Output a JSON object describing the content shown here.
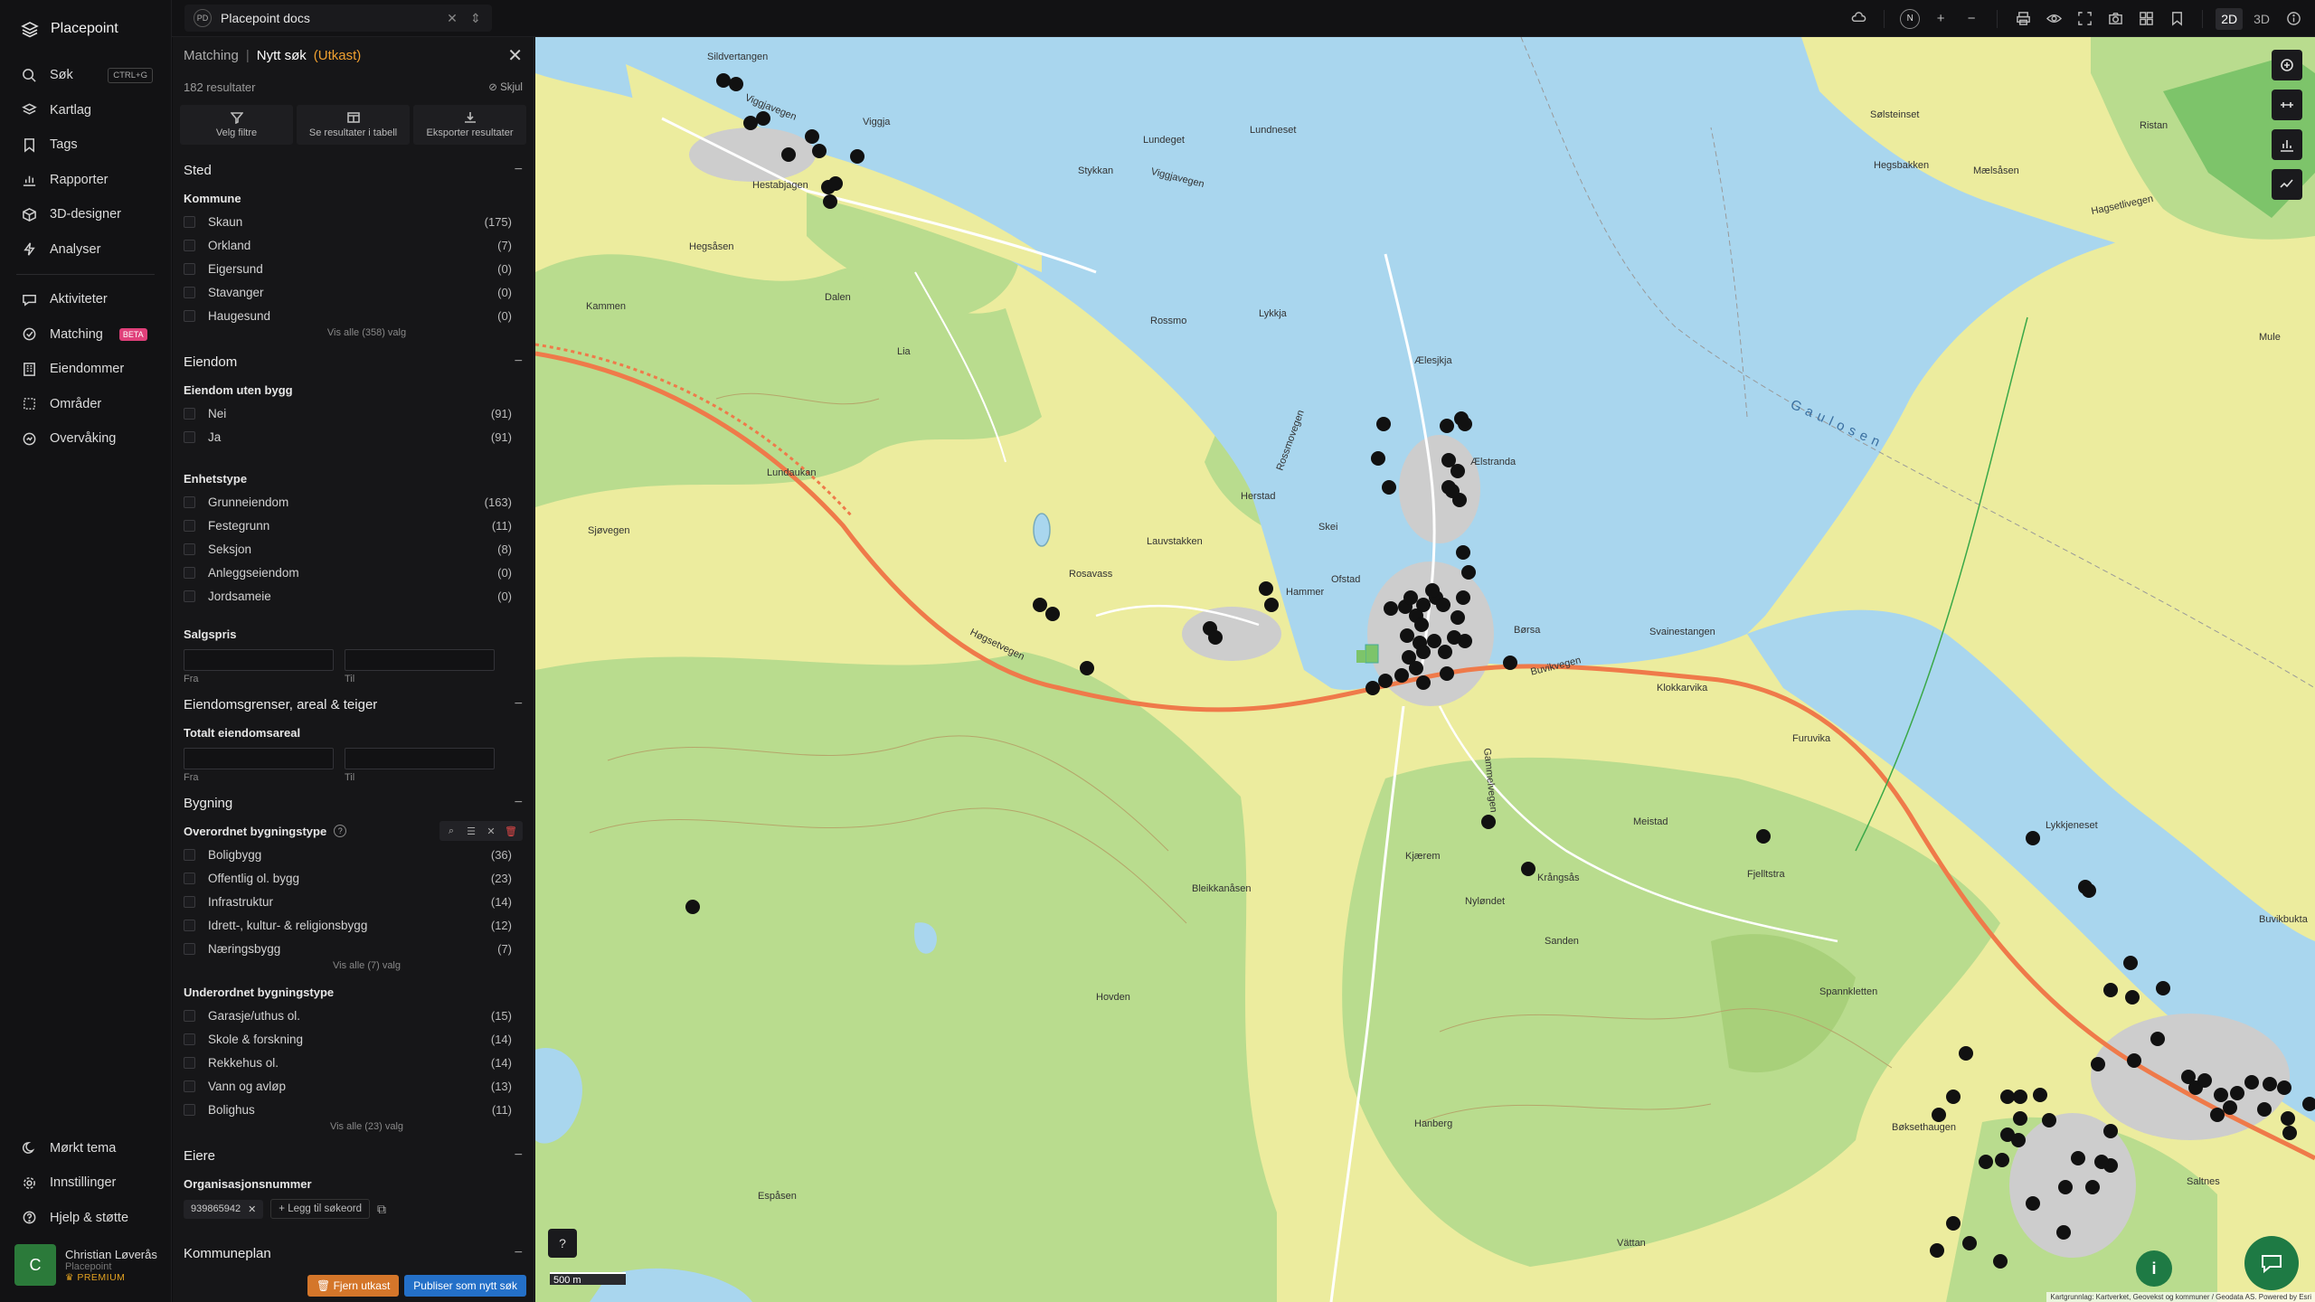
{
  "app": {
    "name": "Placepoint"
  },
  "workspace": {
    "badge": "PD",
    "name": "Placepoint docs"
  },
  "nav": {
    "items": [
      {
        "key": "sok",
        "label": "Søk",
        "shortcut": "CTRL+G",
        "icon": "search-icon"
      },
      {
        "key": "kartlag",
        "label": "Kartlag",
        "icon": "layers-icon"
      },
      {
        "key": "tags",
        "label": "Tags",
        "icon": "bookmark-icon"
      },
      {
        "key": "rapporter",
        "label": "Rapporter",
        "icon": "chart-icon"
      },
      {
        "key": "3d",
        "label": "3D-designer",
        "icon": "cube-icon"
      },
      {
        "key": "analyser",
        "label": "Analyser",
        "icon": "bolt-icon"
      }
    ],
    "items2": [
      {
        "key": "aktiviteter",
        "label": "Aktiviteter",
        "icon": "chat-icon"
      },
      {
        "key": "matching",
        "label": "Matching",
        "badge": "BETA",
        "icon": "match-icon"
      },
      {
        "key": "eiendommer",
        "label": "Eiendommer",
        "icon": "building-icon"
      },
      {
        "key": "omrader",
        "label": "Områder",
        "icon": "area-icon"
      },
      {
        "key": "overvaking",
        "label": "Overvåking",
        "icon": "monitor-icon"
      }
    ],
    "bottom": [
      {
        "key": "theme",
        "label": "Mørkt tema",
        "icon": "moon-icon"
      },
      {
        "key": "settings",
        "label": "Innstillinger",
        "icon": "gear-icon"
      },
      {
        "key": "help",
        "label": "Hjelp & støtte",
        "icon": "help-icon"
      }
    ],
    "user": {
      "initial": "C",
      "name": "Christian Løverås",
      "org": "Placepoint",
      "plan": "PREMIUM"
    }
  },
  "topbar": {
    "compass": "N",
    "mode_2d": "2D",
    "mode_3d": "3D"
  },
  "panel": {
    "crumb": "Matching",
    "title": "Nytt søk",
    "status": "(Utkast)",
    "results": "182 resultater",
    "hide": "Skjul",
    "actions": [
      "Velg filtre",
      "Se resultater i tabell",
      "Eksporter resultater"
    ],
    "sted": {
      "title": "Sted",
      "kommune_label": "Kommune",
      "kommune": [
        {
          "label": "Skaun",
          "count": "(175)"
        },
        {
          "label": "Orkland",
          "count": "(7)"
        },
        {
          "label": "Eigersund",
          "count": "(0)"
        },
        {
          "label": "Stavanger",
          "count": "(0)"
        },
        {
          "label": "Haugesund",
          "count": "(0)"
        }
      ],
      "show_all": "Vis alle (358) valg"
    },
    "eiendom": {
      "title": "Eiendom",
      "uten_bygg_label": "Eiendom uten bygg",
      "uten_bygg": [
        {
          "label": "Nei",
          "count": "(91)"
        },
        {
          "label": "Ja",
          "count": "(91)"
        }
      ],
      "enhetstype_label": "Enhetstype",
      "enhetstype": [
        {
          "label": "Grunneiendom",
          "count": "(163)"
        },
        {
          "label": "Festegrunn",
          "count": "(11)"
        },
        {
          "label": "Seksjon",
          "count": "(8)"
        },
        {
          "label": "Anleggseiendom",
          "count": "(0)"
        },
        {
          "label": "Jordsameie",
          "count": "(0)"
        }
      ],
      "salgspris_label": "Salgspris",
      "from": "Fra",
      "to": "Til"
    },
    "grenser": {
      "title": "Eiendomsgrenser, areal & teiger",
      "areal_label": "Totalt eiendomsareal",
      "from": "Fra",
      "to": "Til"
    },
    "bygning": {
      "title": "Bygning",
      "overordnet_label": "Overordnet bygningstype",
      "overordnet": [
        {
          "label": "Boligbygg",
          "count": "(36)"
        },
        {
          "label": "Offentlig ol. bygg",
          "count": "(23)"
        },
        {
          "label": "Infrastruktur",
          "count": "(14)"
        },
        {
          "label": "Idrett-, kultur- & religionsbygg",
          "count": "(12)"
        },
        {
          "label": "Næringsbygg",
          "count": "(7)"
        }
      ],
      "overordnet_show_all": "Vis alle (7) valg",
      "underordnet_label": "Underordnet bygningstype",
      "underordnet": [
        {
          "label": "Garasje/uthus ol.",
          "count": "(15)"
        },
        {
          "label": "Skole & forskning",
          "count": "(14)"
        },
        {
          "label": "Rekkehus ol.",
          "count": "(14)"
        },
        {
          "label": "Vann og avløp",
          "count": "(13)"
        },
        {
          "label": "Bolighus",
          "count": "(11)"
        }
      ],
      "underordnet_show_all": "Vis alle (23) valg"
    },
    "eiere": {
      "title": "Eiere",
      "org_label": "Organisasjonsnummer",
      "org_value": "939865942",
      "add_label": "Legg til søkeord"
    },
    "kommuneplan": {
      "title": "Kommuneplan"
    },
    "footer": {
      "remove": "Fjern utkast",
      "publish": "Publiser som nytt søk"
    }
  },
  "map": {
    "scale": "500 m",
    "attribution": "Kartgrunnlag: Kartverket, Geovekst og kommuner / Geodata AS. Powered by Esri",
    "colors": {
      "water": "#a9d6ee",
      "land": "#ecec9e",
      "forest": "#b7dc8f",
      "settlement": "#c9c9c9",
      "road": "#ef7a4a"
    },
    "labels": [
      {
        "text": "Sildvertangen"
      },
      {
        "text": "Viggjavegen"
      },
      {
        "text": "Viggja"
      },
      {
        "text": "Lundeget"
      },
      {
        "text": "Lundneset"
      },
      {
        "text": "Hestabjagen"
      },
      {
        "text": "Stykkan"
      },
      {
        "text": "Viggjavegen"
      },
      {
        "text": "Hegsåsen"
      },
      {
        "text": "Sjøvegen"
      },
      {
        "text": "Dalen"
      },
      {
        "text": "Kammen"
      },
      {
        "text": "Lia"
      },
      {
        "text": "Rossmo"
      },
      {
        "text": "Lykkja"
      },
      {
        "text": "Ælesjkja"
      },
      {
        "text": "Rossmovegen"
      },
      {
        "text": "Ælstranda"
      },
      {
        "text": "Herstad"
      },
      {
        "text": "Høgsetvegen"
      },
      {
        "text": "Rosavass"
      },
      {
        "text": "Lauvstakken"
      },
      {
        "text": "Hammer"
      },
      {
        "text": "Ofstad"
      },
      {
        "text": "Børsa"
      },
      {
        "text": "Buvikvegen"
      },
      {
        "text": "Svainestangen"
      },
      {
        "text": "Klokkarvika"
      },
      {
        "text": "Furuvika"
      },
      {
        "text": "Lykkjeneset"
      },
      {
        "text": "Buvikbukta"
      },
      {
        "text": "Meistad"
      },
      {
        "text": "Krångsås"
      },
      {
        "text": "Gammelvegen"
      },
      {
        "text": "Nyløndet"
      },
      {
        "text": "Sanden"
      },
      {
        "text": "Bleikkanåsen"
      },
      {
        "text": "Hovden"
      },
      {
        "text": "Hanberg"
      },
      {
        "text": "Bøksethaugen"
      },
      {
        "text": "Vättan"
      },
      {
        "text": "Gaulosen"
      },
      {
        "text": "Sølsteinset"
      },
      {
        "text": "Hagsetlivegen"
      },
      {
        "text": "Mule"
      },
      {
        "text": "Ristan"
      },
      {
        "text": "Hegsbakken"
      },
      {
        "text": "Mælsåsen"
      },
      {
        "text": "Skei"
      },
      {
        "text": "Kjærem"
      },
      {
        "text": "Espåsen"
      },
      {
        "text": "Lundaukan"
      },
      {
        "text": "Fjelltstra"
      },
      {
        "text": "Spannkletten"
      },
      {
        "text": "Saltnes"
      }
    ]
  }
}
